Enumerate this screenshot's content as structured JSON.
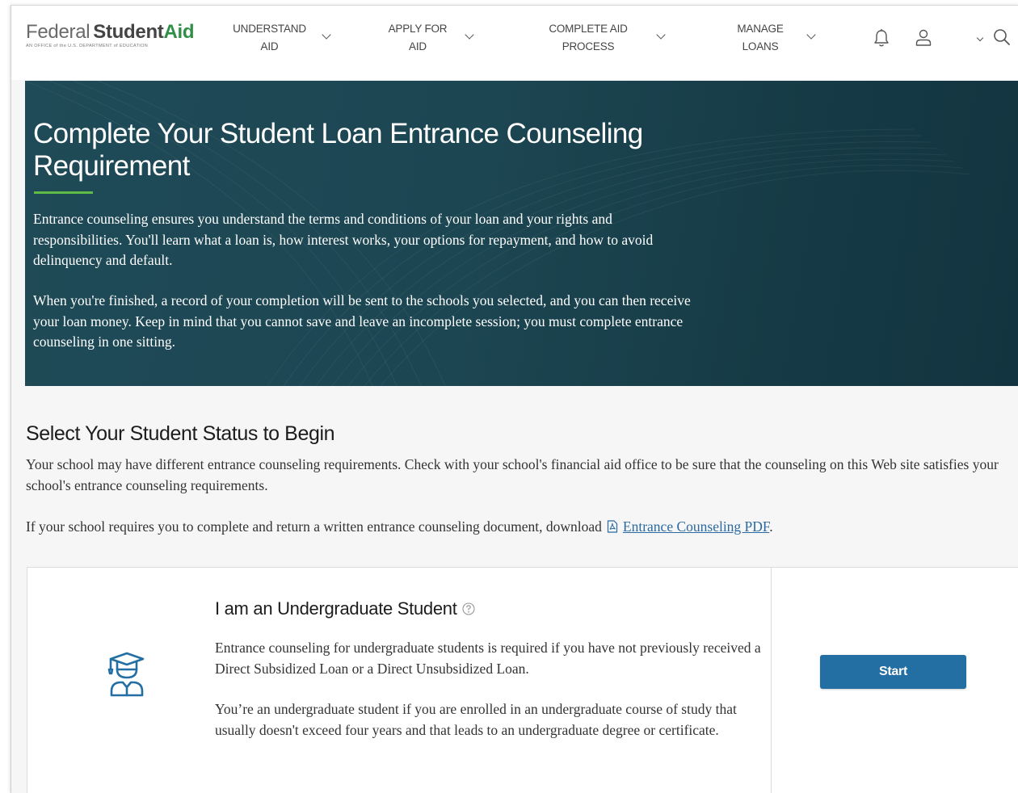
{
  "header": {
    "logo": {
      "word1": "Federal",
      "word2": "Student",
      "word3": "Aid",
      "tagline": "AN OFFICE of the U.S. DEPARTMENT of EDUCATION"
    },
    "nav": [
      {
        "line1": "UNDERSTAND",
        "line2": "AID"
      },
      {
        "line1": "APPLY FOR",
        "line2": "AID"
      },
      {
        "line1": "COMPLETE AID",
        "line2": "PROCESS"
      },
      {
        "line1": "MANAGE",
        "line2": "LOANS"
      }
    ],
    "icons": [
      "bell-icon",
      "user-icon",
      "chevron-down-icon",
      "search-icon"
    ]
  },
  "hero": {
    "title": "Complete Your Student Loan Entrance Counseling Requirement",
    "paragraph1": "Entrance counseling ensures you understand the terms and conditions of your loan and your rights and responsibilities. You'll learn what a loan is, how interest works, your options for repayment, and how to avoid delinquency and default.",
    "paragraph2": "When you're finished, a record of your completion will be sent to the schools you selected, and you can then receive your loan money. Keep in mind that you cannot save and leave an incomplete session; you must complete entrance counseling in one sitting."
  },
  "main": {
    "title": "Select Your Student Status to Begin",
    "intro": "Your school may have different entrance counseling requirements. Check with your school's financial aid office to be sure that the counseling on this Web site satisfies your school's entrance counseling requirements.",
    "pdf_prefix": "If your school requires you to complete and return a written entrance counseling document, download",
    "pdf_link": "Entrance Counseling PDF",
    "pdf_suffix": "."
  },
  "card": {
    "title": "I am an Undergraduate Student",
    "p1": "Entrance counseling for undergraduate students is required if you have not previously received a Direct Subsidized Loan or a Direct Unsubsidized Loan.",
    "p2": "You’re an undergraduate student if you are enrolled in an undergraduate course of study that usually doesn't exceed four years and that leads to an undergraduate degree or certificate.",
    "button": "Start",
    "icon": "graduate-student-icon"
  },
  "colors": {
    "hero_bg": "#1e4754",
    "accent_green": "#5dbb46",
    "button_blue": "#236fa3",
    "link_blue": "#2a6aa0"
  }
}
